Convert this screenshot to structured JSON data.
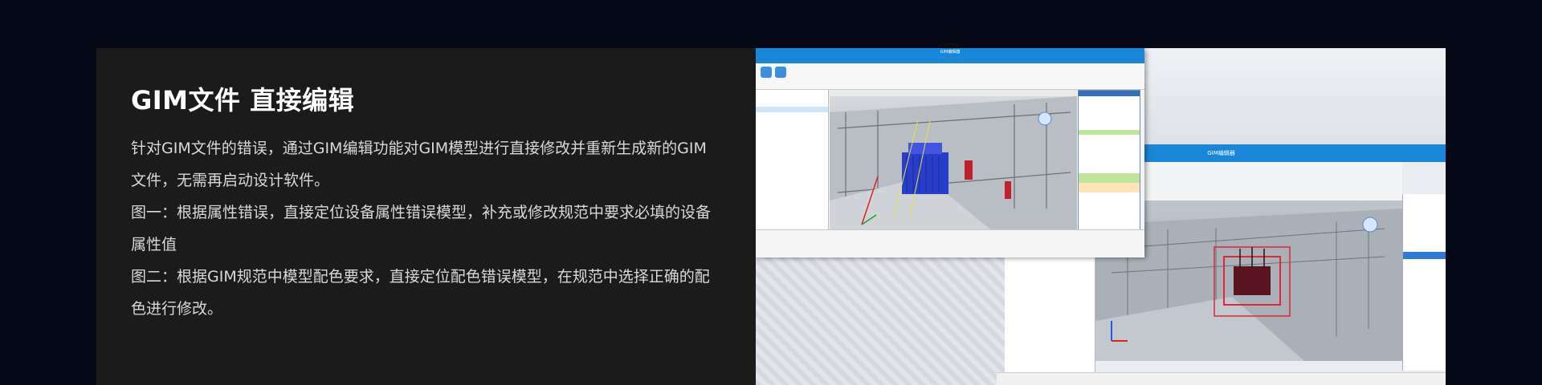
{
  "heading": {
    "title": "GIM文件 直接编辑"
  },
  "description": {
    "line1": "针对GIM文件的错误，通过GIM编辑功能对GIM模型进行直接修改并重新生成新的GIM文件，无需再启动设计软件。",
    "line2": "图一：根据属性错误，直接定位设备属性错误模型，补充或修改规范中要求必填的设备属性值",
    "line3": "图二：根据GIM规范中模型配色要求，直接定位配色错误模型，在规范中选择正确的配色进行修改。"
  },
  "colors": {
    "page_bg": "#060a16",
    "card_bg": "#1b1b1c",
    "title_text": "#ffffff",
    "body_text": "#d9d9d9",
    "app_accent": "#1a86d8",
    "transformer_blue": "#2a3fc9",
    "highlight_red": "#e0263a"
  },
  "screenshots": {
    "front_window_title": "GIM编辑器",
    "back_window_title": "GIM编辑器"
  }
}
